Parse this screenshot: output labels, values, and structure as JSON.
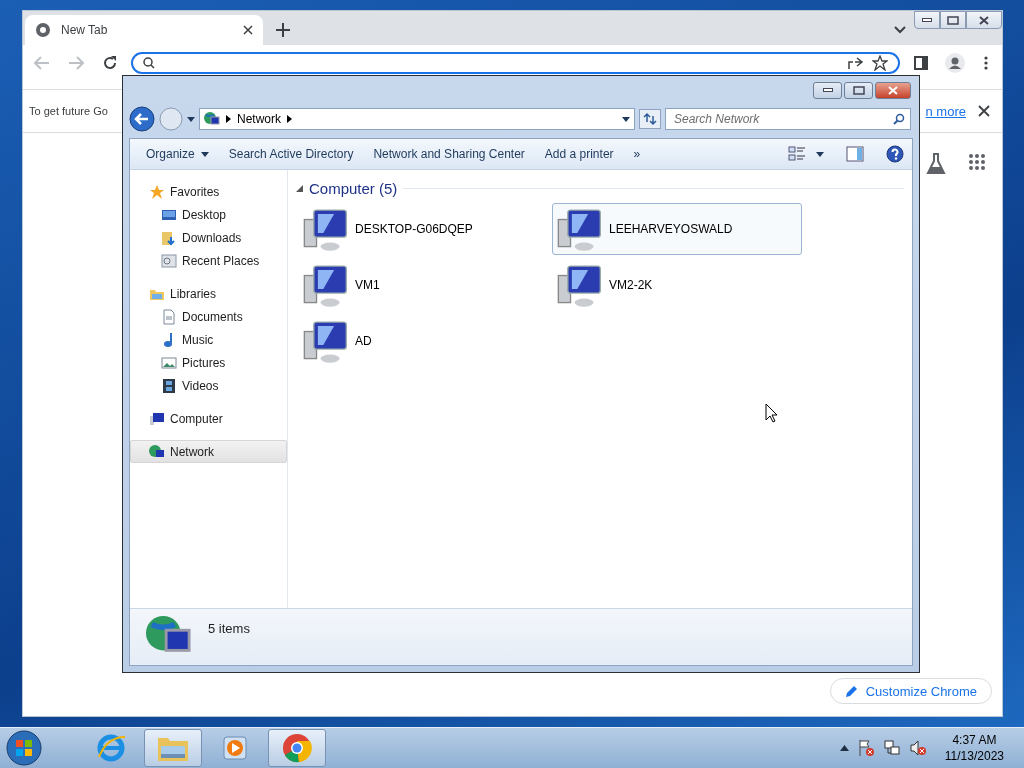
{
  "chrome": {
    "tab": {
      "title": "New Tab",
      "selected": true
    },
    "infobar": {
      "message": "To get future Go",
      "link": "n more"
    },
    "customize_button": "Customize Chrome"
  },
  "explorer": {
    "breadcrumb": [
      "Network"
    ],
    "search": {
      "placeholder": "Search Network"
    },
    "commands": [
      {
        "label": "Organize",
        "dropdown": true
      },
      {
        "label": "Search Active Directory",
        "dropdown": false
      },
      {
        "label": "Network and Sharing Center",
        "dropdown": false
      },
      {
        "label": "Add a printer",
        "dropdown": false
      }
    ],
    "overflow": "»",
    "navigation": [
      {
        "label": "Favorites",
        "kind": "favorites",
        "selected": false,
        "children": [
          {
            "label": "Desktop",
            "kind": "desktop",
            "selected": false
          },
          {
            "label": "Downloads",
            "kind": "downloads",
            "selected": false
          },
          {
            "label": "Recent Places",
            "kind": "recent",
            "selected": false
          }
        ]
      },
      {
        "label": "Libraries",
        "kind": "libraries",
        "selected": false,
        "children": [
          {
            "label": "Documents",
            "kind": "documents",
            "selected": false
          },
          {
            "label": "Music",
            "kind": "music",
            "selected": false
          },
          {
            "label": "Pictures",
            "kind": "pictures",
            "selected": false
          },
          {
            "label": "Videos",
            "kind": "videos",
            "selected": false
          }
        ]
      },
      {
        "label": "Computer",
        "kind": "computer",
        "selected": false
      },
      {
        "label": "Network",
        "kind": "network",
        "selected": true
      }
    ],
    "group": {
      "title": "Computer (5)",
      "expanded": true
    },
    "items": [
      {
        "name": "DESKTOP-G06DQEP",
        "selected": false
      },
      {
        "name": "LEEHARVEYOSWALD",
        "selected": true
      },
      {
        "name": "VM1",
        "selected": false
      },
      {
        "name": "VM2-2K",
        "selected": false
      },
      {
        "name": "AD",
        "selected": false
      }
    ],
    "status": "5 items"
  },
  "taskbar": {
    "items": [
      {
        "kind": "ie",
        "running": false
      },
      {
        "kind": "explorer",
        "running": true
      },
      {
        "kind": "media",
        "running": false
      },
      {
        "kind": "chrome",
        "running": true
      }
    ],
    "clock": {
      "time": "4:37 AM",
      "date": "11/13/2023"
    }
  }
}
